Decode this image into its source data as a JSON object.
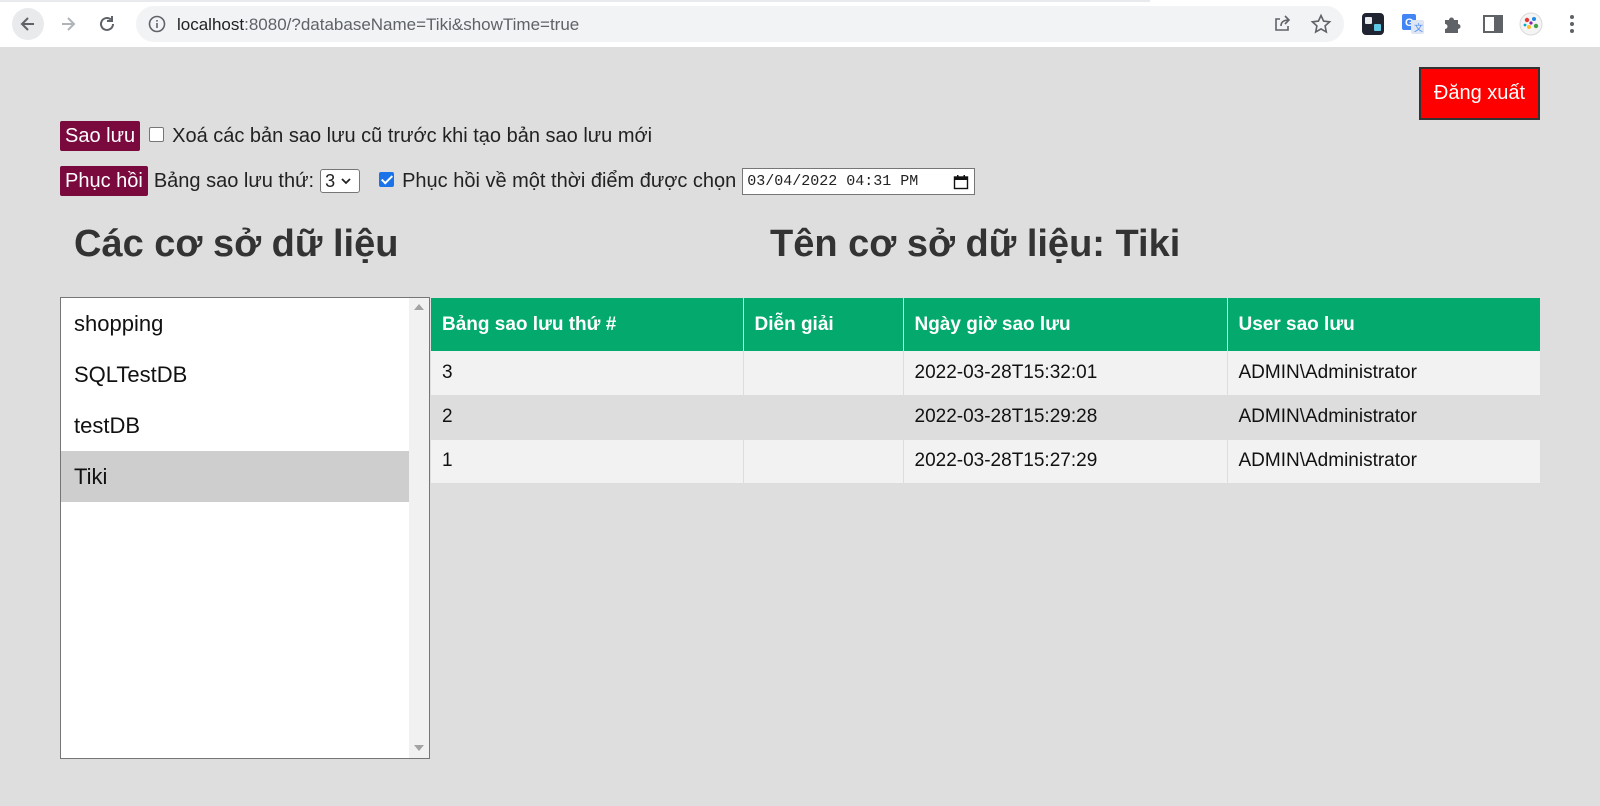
{
  "browser": {
    "url_host": "localhost",
    "url_rest": ":8080/?databaseName=Tiki&showTime=true",
    "icons": [
      "back-icon",
      "forward-icon",
      "reload-icon",
      "info-icon",
      "share-icon",
      "star-icon",
      "extension-terminal-icon",
      "extension-translate-icon",
      "extensions-puzzle-icon",
      "sidepanel-icon",
      "profile-avatar-icon",
      "menu-kebab-icon"
    ]
  },
  "header": {
    "logout_label": "Đăng xuất"
  },
  "backup": {
    "button_label": "Sao lưu",
    "delete_old_label": "Xoá các bản sao lưu cũ trước khi tạo bản sao lưu mới",
    "delete_old_checked": false
  },
  "restore": {
    "button_label": "Phục hồi",
    "table_label": "Bảng sao lưu thứ:",
    "table_selected": "3",
    "point_in_time_label": "Phục hồi về một thời điểm được chọn",
    "point_in_time_checked": true,
    "datetime_value": "03/04/2022 04:31 PM"
  },
  "databases": {
    "heading": "Các cơ sở dữ liệu",
    "items": [
      "shopping",
      "SQLTestDB",
      "testDB",
      "Tiki"
    ],
    "selected": "Tiki"
  },
  "detail": {
    "heading": "Tên cơ sở dữ liệu: Tiki",
    "columns": [
      "Bảng sao lưu thứ #",
      "Diễn giải",
      "Ngày giờ sao lưu",
      "User sao lưu"
    ],
    "rows": [
      [
        "3",
        "",
        "2022-03-28T15:32:01",
        "ADMIN\\Administrator"
      ],
      [
        "2",
        "",
        "2022-03-28T15:29:28",
        "ADMIN\\Administrator"
      ],
      [
        "1",
        "",
        "2022-03-28T15:27:29",
        "ADMIN\\Administrator"
      ]
    ]
  },
  "colors": {
    "page_bg": "#dedede",
    "logout_bg": "#ff0000",
    "action_bg": "#7a0a3e",
    "table_header_bg": "#04aa6d"
  }
}
